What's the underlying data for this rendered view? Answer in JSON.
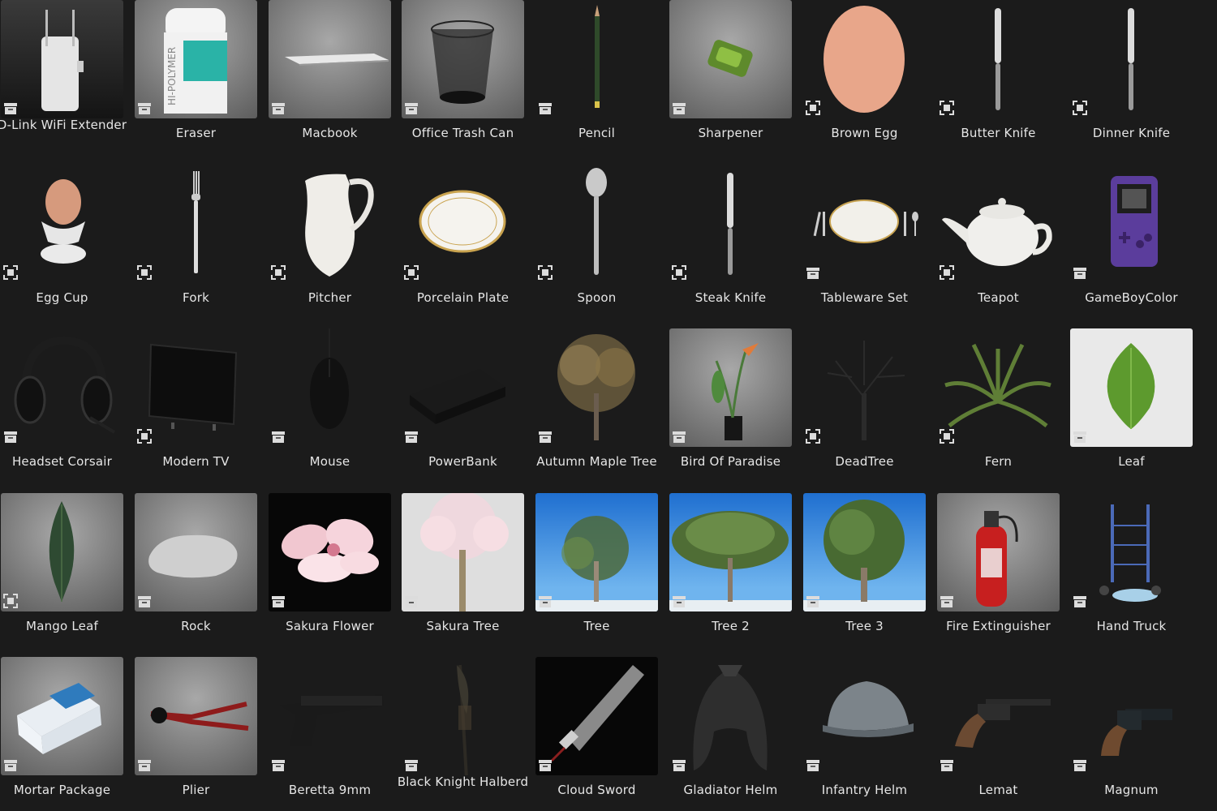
{
  "assets": [
    {
      "name": "D-Link WiFi Extender",
      "badge": "collection",
      "bg": "dark-grad",
      "art": "router"
    },
    {
      "name": "Eraser",
      "badge": "collection",
      "bg": "light-grad",
      "art": "eraser"
    },
    {
      "name": "Macbook",
      "badge": "collection",
      "bg": "light-grad",
      "art": "laptop"
    },
    {
      "name": "Office Trash Can",
      "badge": "collection",
      "bg": "light-grad",
      "art": "trash"
    },
    {
      "name": "Pencil",
      "badge": "collection",
      "bg": "dark",
      "art": "pencil"
    },
    {
      "name": "Sharpener",
      "badge": "collection",
      "bg": "light-grad",
      "art": "sharpener"
    },
    {
      "name": "Brown Egg",
      "badge": "object",
      "bg": "dark",
      "art": "egg"
    },
    {
      "name": "Butter Knife",
      "badge": "object",
      "bg": "dark",
      "art": "knife"
    },
    {
      "name": "Dinner Knife",
      "badge": "object",
      "bg": "dark",
      "art": "knife"
    },
    {
      "name": "Egg Cup",
      "badge": "object",
      "bg": "dark",
      "art": "eggcup"
    },
    {
      "name": "Fork",
      "badge": "object",
      "bg": "dark",
      "art": "fork"
    },
    {
      "name": "Pitcher",
      "badge": "object",
      "bg": "dark",
      "art": "pitcher"
    },
    {
      "name": "Porcelain Plate",
      "badge": "object",
      "bg": "dark",
      "art": "plate"
    },
    {
      "name": "Spoon",
      "badge": "object",
      "bg": "dark",
      "art": "spoon"
    },
    {
      "name": "Steak Knife",
      "badge": "object",
      "bg": "dark",
      "art": "knife"
    },
    {
      "name": "Tableware Set",
      "badge": "collection",
      "bg": "dark",
      "art": "tableware"
    },
    {
      "name": "Teapot",
      "badge": "object",
      "bg": "dark",
      "art": "teapot"
    },
    {
      "name": "GameBoyColor",
      "badge": "collection",
      "bg": "dark",
      "art": "gameboy"
    },
    {
      "name": "Headset Corsair",
      "badge": "collection",
      "bg": "dark",
      "art": "headset"
    },
    {
      "name": "Modern TV",
      "badge": "object",
      "bg": "dark",
      "art": "tv"
    },
    {
      "name": "Mouse",
      "badge": "collection",
      "bg": "dark",
      "art": "mouse"
    },
    {
      "name": "PowerBank",
      "badge": "collection",
      "bg": "dark",
      "art": "powerbank"
    },
    {
      "name": "Autumn Maple Tree",
      "badge": "collection",
      "bg": "dark",
      "art": "maple"
    },
    {
      "name": "Bird Of Paradise",
      "badge": "collection",
      "bg": "light-grad",
      "art": "plant"
    },
    {
      "name": "DeadTree",
      "badge": "object",
      "bg": "dark",
      "art": "deadtree"
    },
    {
      "name": "Fern",
      "badge": "object",
      "bg": "dark",
      "art": "fern"
    },
    {
      "name": "Leaf",
      "badge": "collection",
      "bg": "white",
      "art": "leaf"
    },
    {
      "name": "Mango Leaf",
      "badge": "object",
      "bg": "light-grad",
      "art": "mangoleaf"
    },
    {
      "name": "Rock",
      "badge": "collection",
      "bg": "light-grad",
      "art": "rock"
    },
    {
      "name": "Sakura Flower",
      "badge": "collection",
      "bg": "black",
      "art": "flower"
    },
    {
      "name": "Sakura Tree",
      "badge": "collection",
      "bg": "pale",
      "art": "sakura"
    },
    {
      "name": "Tree",
      "badge": "collection",
      "bg": "sky",
      "art": "tree"
    },
    {
      "name": "Tree 2",
      "badge": "collection",
      "bg": "sky",
      "art": "tree2"
    },
    {
      "name": "Tree 3",
      "badge": "collection",
      "bg": "sky",
      "art": "tree3"
    },
    {
      "name": "Fire Extinguisher",
      "badge": "collection",
      "bg": "light-grad",
      "art": "extinguisher"
    },
    {
      "name": "Hand Truck",
      "badge": "collection",
      "bg": "dark",
      "art": "handtruck"
    },
    {
      "name": "Mortar Package",
      "badge": "collection",
      "bg": "light-grad",
      "art": "package"
    },
    {
      "name": "Plier",
      "badge": "collection",
      "bg": "light-grad",
      "art": "plier"
    },
    {
      "name": "Beretta 9mm",
      "badge": "collection",
      "bg": "dark",
      "art": "pistol"
    },
    {
      "name": "Black Knight Halberd",
      "badge": "collection",
      "bg": "dark",
      "art": "halberd"
    },
    {
      "name": "Cloud Sword",
      "badge": "collection",
      "bg": "black",
      "art": "sword"
    },
    {
      "name": "Gladiator Helm",
      "badge": "collection",
      "bg": "dark",
      "art": "helm"
    },
    {
      "name": "Infantry Helm",
      "badge": "collection",
      "bg": "dark",
      "art": "infhelm"
    },
    {
      "name": "Lemat",
      "badge": "collection",
      "bg": "dark",
      "art": "revolver"
    },
    {
      "name": "Magnum",
      "badge": "collection",
      "bg": "dark",
      "art": "magnum"
    }
  ]
}
